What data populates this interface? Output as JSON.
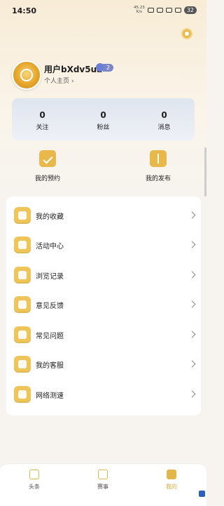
{
  "status": {
    "time": "14:50",
    "net_speed": "45.23",
    "net_unit": "K/s",
    "battery": "32"
  },
  "profile": {
    "username": "用户bXdv5ua",
    "level": "2",
    "home_link": "个人主页"
  },
  "stats": [
    {
      "value": "0",
      "label": "关注"
    },
    {
      "value": "0",
      "label": "粉丝"
    },
    {
      "value": "0",
      "label": "消息"
    }
  ],
  "quick_actions": {
    "appointments": "我的预约",
    "posts": "我的发布"
  },
  "menu": [
    {
      "label": "我的收藏",
      "icon": "star-icon"
    },
    {
      "label": "活动中心",
      "icon": "gift-icon"
    },
    {
      "label": "浏览记录",
      "icon": "clock-icon"
    },
    {
      "label": "意见反馈",
      "icon": "chat-icon"
    },
    {
      "label": "常见问题",
      "icon": "question-icon"
    },
    {
      "label": "我的客服",
      "icon": "headset-icon"
    },
    {
      "label": "网络测速",
      "icon": "compass-icon"
    }
  ],
  "tabbar": {
    "tab1": "头条",
    "tab2": "赛事",
    "tab3": "我的"
  },
  "colors": {
    "accent": "#e1b74d",
    "active_tab": "#d9a93c"
  }
}
